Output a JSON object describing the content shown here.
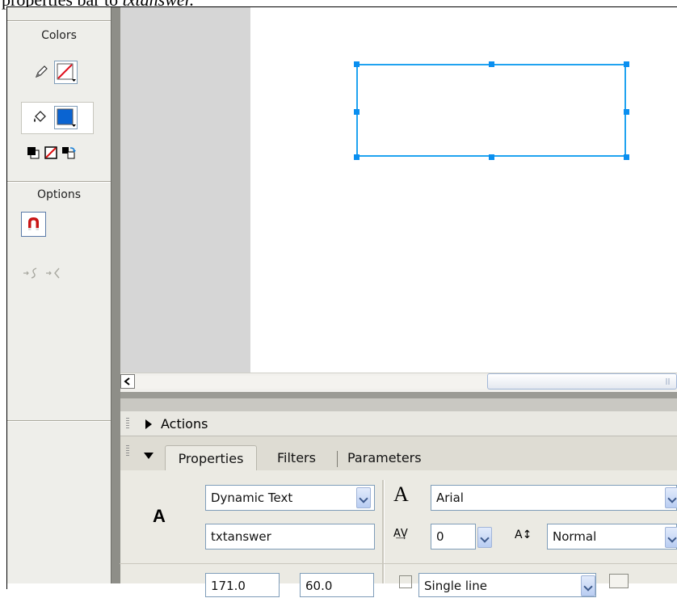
{
  "caption": {
    "text": "properties bar to ",
    "emphasis": "txtanswer."
  },
  "tools": {
    "colors_header": "Colors",
    "options_header": "Options",
    "stroke_swatch_icon": "stroke-none-icon",
    "fill_color": "#0a64d2",
    "snap_icon": "magnet-icon"
  },
  "stage": {
    "selection_color": "#20a3f0"
  },
  "panels": {
    "actions_title": "Actions",
    "tabs": {
      "properties": "Properties",
      "filters": "Filters",
      "parameters": "Parameters"
    },
    "text_type": "Dynamic Text",
    "instance_name": "txtanswer",
    "font": "Arial",
    "letter_spacing": "0",
    "baseline": "Normal",
    "bottom_w": "171.0",
    "bottom_h": "60.0",
    "line_type": "Single line"
  }
}
